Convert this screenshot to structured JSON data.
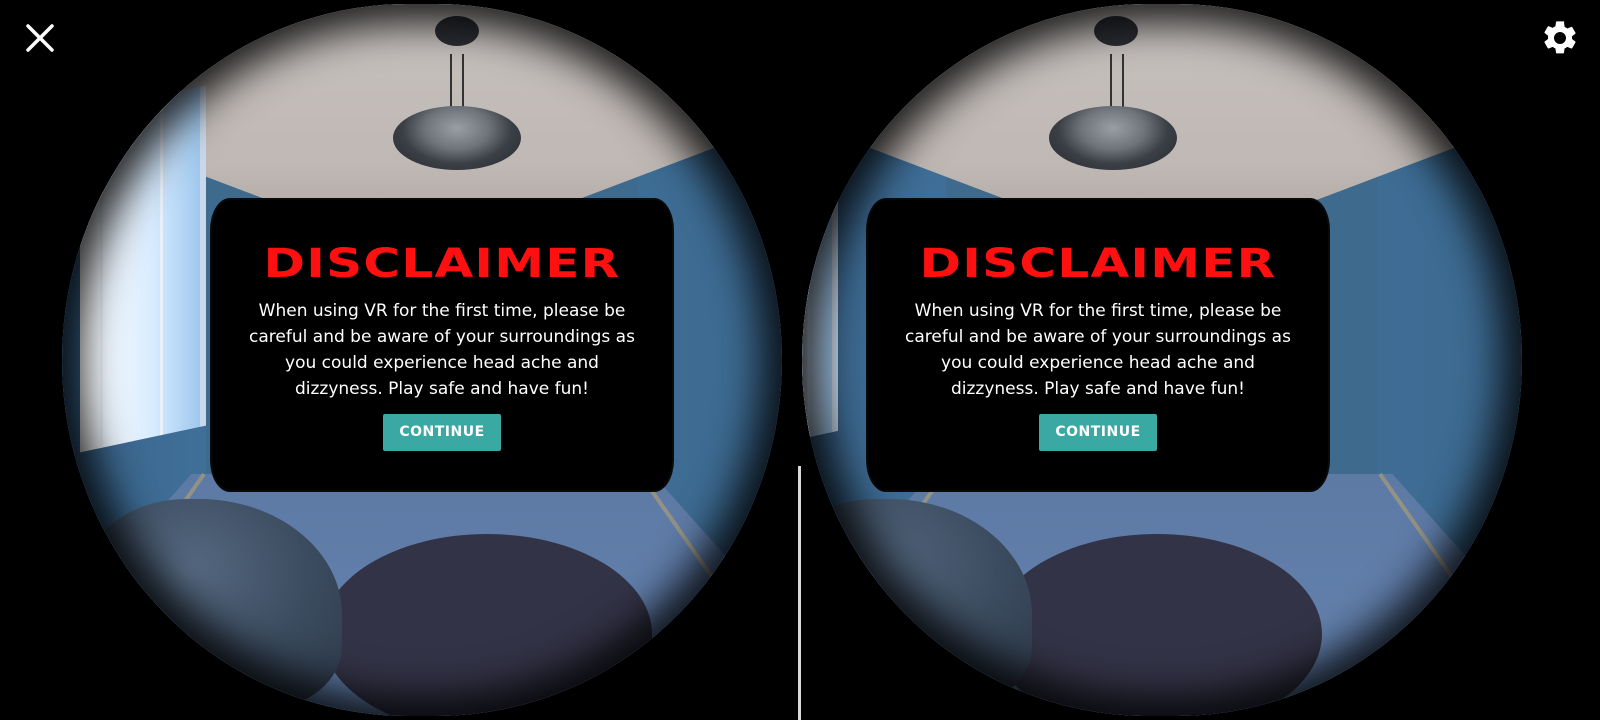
{
  "toolbar": {
    "close_icon": "close-icon",
    "settings_icon": "gear-icon"
  },
  "disclaimer": {
    "title": "DISCLAIMER",
    "message": "When using VR for the first time, please be careful and be aware of your surroundings as you could experience head ache and dizzyness. Play safe and have fun!",
    "continue_label": "CONTINUE"
  },
  "colors": {
    "title_red": "#ff1010",
    "button_teal": "#3aa9a3",
    "wall_blue": "#3f6b8e"
  }
}
